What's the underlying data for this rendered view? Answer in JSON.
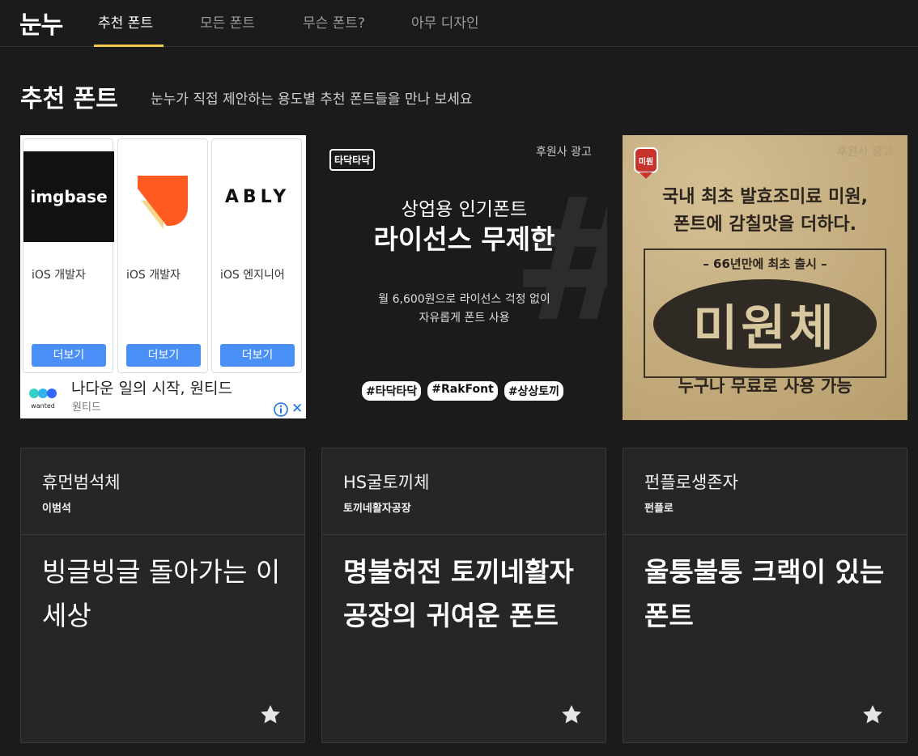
{
  "nav": {
    "logo": "눈누",
    "tabs": [
      {
        "label": "추천 폰트",
        "active": true
      },
      {
        "label": "모든 폰트",
        "active": false
      },
      {
        "label": "무슨 폰트?",
        "active": false
      },
      {
        "label": "아무 디자인",
        "active": false
      }
    ],
    "accent_color": "#f2c94c"
  },
  "heading": {
    "title": "추천 폰트",
    "subtitle": "눈누가 직접 제안하는 용도별 추천 폰트들을 만나 보세요"
  },
  "ads": {
    "jobs_ad": {
      "cards": [
        {
          "company_logo": "imgbase",
          "role": "iOS 개발자",
          "button": "더보기"
        },
        {
          "company_logo": "orange-heart-logo",
          "role": "iOS 개발자",
          "button": "더보기"
        },
        {
          "company_logo": "ABLY",
          "role": "iOS 엔지니어",
          "button": "더보기"
        }
      ],
      "footer_logo_text": "wanted",
      "headline": "나다운 일의 시작, 원티드",
      "brand": "원티드",
      "close_label": "✕"
    },
    "font_ad": {
      "logo": "타닥타닥",
      "sponsor": "후원사 광고",
      "kicker": "상업용 인기폰트",
      "headline": "라이선스 무제한",
      "desc_line1": "월 6,600원으로 라이선스 걱정 없이",
      "desc_line2": "자유롭게 폰트 사용",
      "tags": [
        "#타닥타닥",
        "#RakFont",
        "#상상토끼"
      ]
    },
    "poster_ad": {
      "badge": "미원",
      "sponsor": "후원사 광고",
      "line1": "국내 최초 발효조미료 미원,",
      "line2": "폰트에 감칠맛을 더하다.",
      "since": "– 66년만에 최초 출시 –",
      "name": "미원체",
      "bottom": "누구나 무료로 사용 가능"
    }
  },
  "font_cards": [
    {
      "name": "휴먼범석체",
      "author": "이범석",
      "sample": "빙글빙글 돌아가는 이 세상"
    },
    {
      "name": "HS굴토끼체",
      "author": "토끼네활자공장",
      "sample": "명불허전 토끼네활자공장의 귀여운 폰트"
    },
    {
      "name": "펀플로생존자",
      "author": "펀플로",
      "sample": "울퉁불퉁 크랙이 있는 폰트"
    }
  ]
}
